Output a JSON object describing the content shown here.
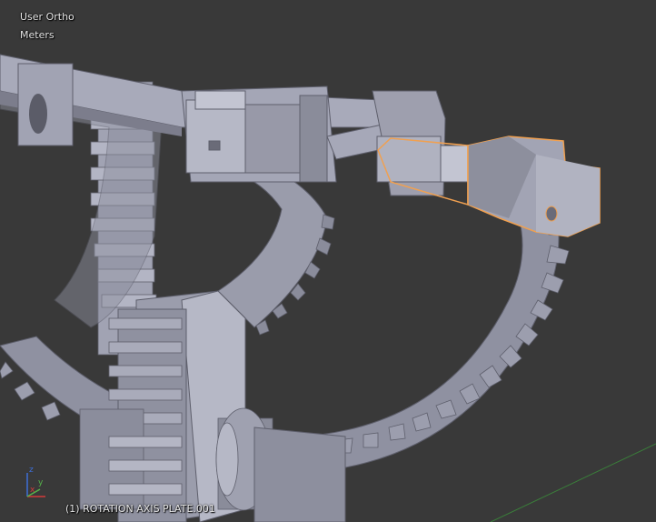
{
  "viewport": {
    "view_name": "User Ortho",
    "units": "Meters",
    "object_info": "(1) ROTATION AXIS PLATE.001"
  },
  "axis_widget": {
    "x_label": "x",
    "y_label": "y",
    "z_label": "z",
    "x_color": "#d43b3b",
    "y_color": "#55b34a",
    "z_color": "#3d6fd9"
  },
  "colors": {
    "background": "#393939",
    "metal_light": "#a4a6b6",
    "metal_mid": "#8f91a1",
    "metal_dark": "#6b6c7a",
    "selection_outline": "#f0a050",
    "grid_line_green": "#3a7d3a"
  }
}
